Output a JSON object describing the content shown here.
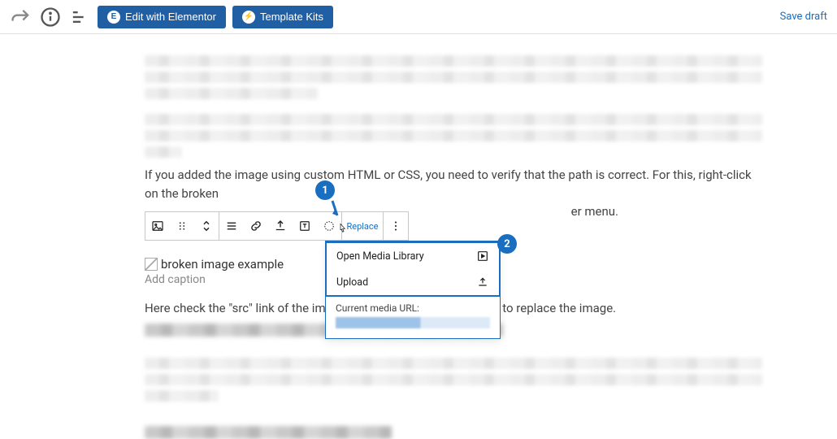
{
  "toolbar": {
    "edit_elementor": "Edit with Elementor",
    "template_kits": "Template Kits",
    "save_draft": "Save draft"
  },
  "content": {
    "para_line1": "If you added the image using custom HTML or CSS, you need to verify that the path is correct. For this, right-click on the broken",
    "para_line2_tail": "er menu.",
    "broken_alt": "broken image example",
    "caption_placeholder": "Add caption",
    "para2": "Here check the \"src\" link of the image a                                                   . Otherwise, you may need to replace the image."
  },
  "block_toolbar": {
    "replace": "Replace"
  },
  "dropdown": {
    "open_media": "Open Media Library",
    "upload": "Upload",
    "current_url_label": "Current media URL:"
  },
  "callouts": {
    "one": "1",
    "two": "2"
  }
}
